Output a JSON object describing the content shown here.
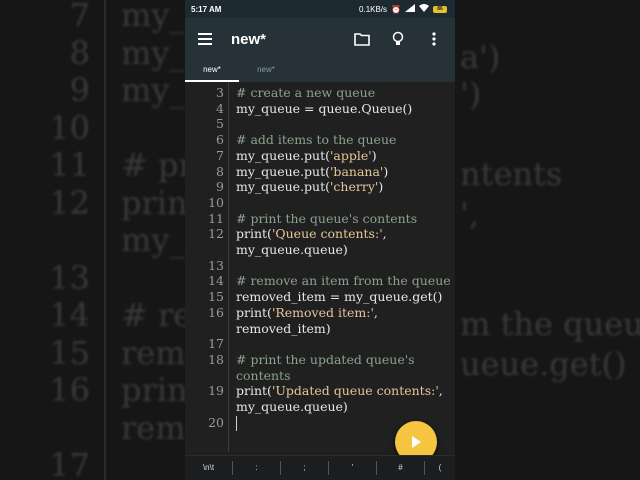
{
  "background": {
    "lines": [
      {
        "num": "7",
        "text": "my_"
      },
      {
        "num": "8",
        "text": "my_"
      },
      {
        "num": "9",
        "text": "my_"
      },
      {
        "num": "10",
        "text": ")"
      },
      {
        "num": "11",
        "text": "# pri"
      },
      {
        "num": "12",
        "text": "prin"
      },
      {
        "num": "",
        "text": "my_"
      },
      {
        "num": "13",
        "text": ""
      },
      {
        "num": "14",
        "text": "# ren"
      },
      {
        "num": "15",
        "text": "rem"
      },
      {
        "num": "16",
        "text": "prin"
      },
      {
        "num": "",
        "text": "rem"
      },
      {
        "num": "17",
        "text": ""
      }
    ],
    "right_fragments": [
      "a')",
      "')",
      "ntents",
      "',",
      "m the queue",
      "ueue.get()"
    ]
  },
  "statusbar": {
    "time": "5:17 AM",
    "speed": "0.1KB/s",
    "battery": "86"
  },
  "appbar": {
    "title": "new*",
    "icons": [
      "menu-icon",
      "folder-icon",
      "lightbulb-icon",
      "more-vert-icon"
    ]
  },
  "tabs": [
    {
      "label": "new*",
      "active": true
    },
    {
      "label": "new*",
      "active": false
    }
  ],
  "editor": {
    "lines": [
      {
        "num": "3",
        "parts": [
          {
            "t": "# create a new queue",
            "c": "comment"
          }
        ]
      },
      {
        "num": "4",
        "parts": [
          {
            "t": "my_queue = queue.Queue()",
            "c": "plain"
          }
        ]
      },
      {
        "num": "5",
        "parts": []
      },
      {
        "num": "6",
        "parts": [
          {
            "t": "# add items to the queue",
            "c": "comment"
          }
        ]
      },
      {
        "num": "7",
        "parts": [
          {
            "t": "my_queue.put(",
            "c": "plain"
          },
          {
            "t": "'apple'",
            "c": "string"
          },
          {
            "t": ")",
            "c": "plain"
          }
        ]
      },
      {
        "num": "8",
        "parts": [
          {
            "t": "my_queue.put(",
            "c": "plain"
          },
          {
            "t": "'banana'",
            "c": "string"
          },
          {
            "t": ")",
            "c": "plain"
          }
        ]
      },
      {
        "num": "9",
        "parts": [
          {
            "t": "my_queue.put(",
            "c": "plain"
          },
          {
            "t": "'cherry'",
            "c": "string"
          },
          {
            "t": ")",
            "c": "plain"
          }
        ]
      },
      {
        "num": "10",
        "parts": []
      },
      {
        "num": "11",
        "parts": [
          {
            "t": "# print the queue's contents",
            "c": "comment"
          }
        ]
      },
      {
        "num": "12",
        "parts": [
          {
            "t": "print(",
            "c": "plain"
          },
          {
            "t": "'Queue contents:'",
            "c": "string"
          },
          {
            "t": ",",
            "c": "plain"
          }
        ]
      },
      {
        "num": "",
        "parts": [
          {
            "t": "my_queue.queue)",
            "c": "plain"
          }
        ]
      },
      {
        "num": "13",
        "parts": []
      },
      {
        "num": "14",
        "parts": [
          {
            "t": "# remove an item from the queue",
            "c": "comment"
          }
        ]
      },
      {
        "num": "15",
        "parts": [
          {
            "t": "removed_item = my_queue.get()",
            "c": "plain"
          }
        ]
      },
      {
        "num": "16",
        "parts": [
          {
            "t": "print(",
            "c": "plain"
          },
          {
            "t": "'Removed item:'",
            "c": "string"
          },
          {
            "t": ",",
            "c": "plain"
          }
        ]
      },
      {
        "num": "",
        "parts": [
          {
            "t": "removed_item)",
            "c": "plain"
          }
        ]
      },
      {
        "num": "17",
        "parts": []
      },
      {
        "num": "18",
        "parts": [
          {
            "t": "# print the updated queue's",
            "c": "comment"
          }
        ]
      },
      {
        "num": "",
        "parts": [
          {
            "t": "contents",
            "c": "comment"
          }
        ]
      },
      {
        "num": "19",
        "parts": [
          {
            "t": "print(",
            "c": "plain"
          },
          {
            "t": "'Updated queue contents:'",
            "c": "string"
          },
          {
            "t": ",",
            "c": "plain"
          }
        ]
      },
      {
        "num": "",
        "parts": [
          {
            "t": "my_queue.queue)",
            "c": "plain"
          }
        ]
      },
      {
        "num": "20",
        "parts": []
      }
    ]
  },
  "fab": {
    "icon": "play-icon"
  },
  "keys": [
    "\\n\\t",
    ":",
    ";",
    "'",
    "#",
    "("
  ]
}
